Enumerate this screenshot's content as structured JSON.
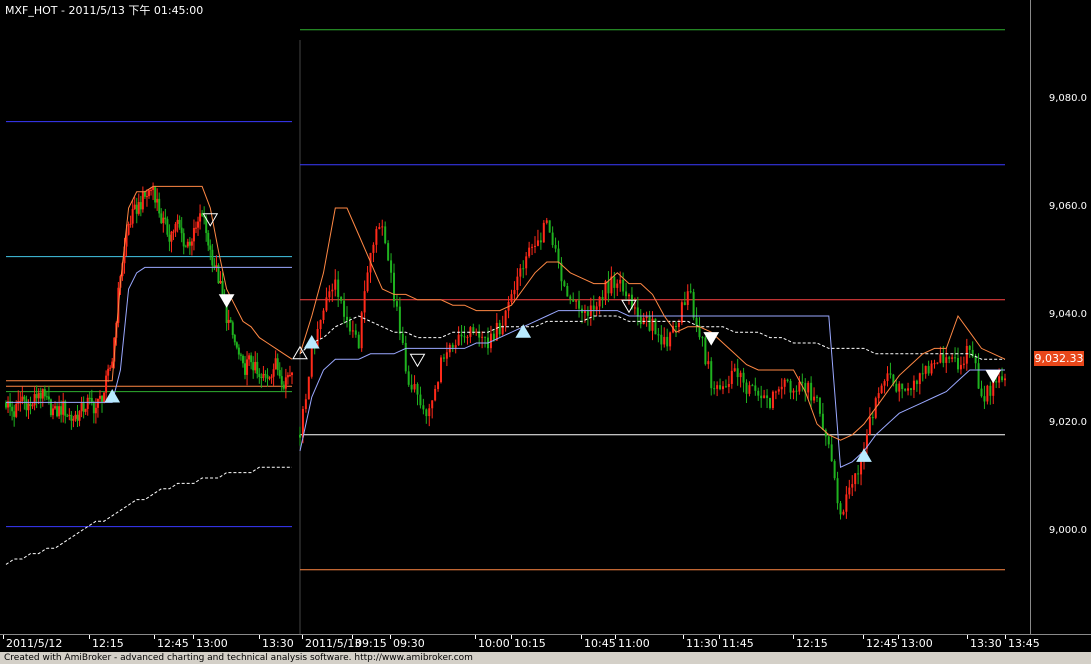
{
  "title": "MXF_HOT - 2011/5/13 下午 01:45:00",
  "footer": "Created with AmiBroker - advanced charting and technical analysis software. http://www.amibroker.com",
  "last_price_label": "9,032.33",
  "colors": {
    "background": "#000000",
    "bull_candle": "#ff2a1a",
    "bear_candle": "#1fb21f",
    "band_upper": "#3a3aff",
    "band_mid": "#44c8e8",
    "band_lower": "#2faf2f",
    "stop_line": "#ff8844",
    "trail_line": "#9aa8ff",
    "ma_line": "#ffffff",
    "price_badge": "#e8471a"
  },
  "chart_data": {
    "type": "candlestick",
    "title": "MXF_HOT - 2011/5/13 下午 01:45:00",
    "ylim": [
      8990,
      9100
    ],
    "y_ticks": [
      {
        "value": 9000,
        "label": "9,000.0"
      },
      {
        "value": 9020,
        "label": "9,020.0"
      },
      {
        "value": 9040,
        "label": "9,040.0"
      },
      {
        "value": 9060,
        "label": "9,060.0"
      },
      {
        "value": 9080,
        "label": "9,080.0"
      }
    ],
    "x_ticks": [
      "2011/5/12",
      "12:15",
      "12:45",
      "13:00",
      "13:30",
      "2011/5/13",
      "09:15",
      "09:30",
      "10:00",
      "10:15",
      "10:45",
      "11:00",
      "11:30",
      "11:45",
      "12:15",
      "12:45",
      "13:00",
      "13:30",
      "13:45"
    ],
    "last_price": 9032.33,
    "sessions": [
      {
        "date": "2011/5/12",
        "levels": [
          {
            "name": "upper-band",
            "value": 9076,
            "color": "#3a3aff"
          },
          {
            "name": "mid-band",
            "value": 9051,
            "color": "#44c8e8"
          },
          {
            "name": "stop-band",
            "value": 9027,
            "color": "#ff8844"
          },
          {
            "name": "lower-band-green",
            "value": 9026,
            "color": "#2faf2f"
          },
          {
            "name": "lower-band",
            "value": 9001,
            "color": "#3a3aff"
          }
        ],
        "close_path": [
          9024,
          9022,
          9025,
          9023,
          9026,
          9024,
          9022,
          9023,
          9021,
          9022,
          9024,
          9023,
          9026,
          9032,
          9048,
          9057,
          9060,
          9062,
          9064,
          9058,
          9055,
          9057,
          9053,
          9055,
          9059,
          9052,
          9047,
          9040,
          9035,
          9030,
          9032,
          9028,
          9029,
          9031,
          9028,
          9030
        ],
        "stop_line": [
          9028,
          9028,
          9028,
          9028,
          9028,
          9028,
          9028,
          9028,
          9028,
          9028,
          9028,
          9028,
          9028,
          9028,
          9046,
          9060,
          9063,
          9063,
          9064,
          9064,
          9064,
          9064,
          9064,
          9064,
          9064,
          9060,
          9052,
          9045,
          9042,
          9039,
          9038,
          9036,
          9035,
          9034,
          9033,
          9032
        ],
        "trail_line": [
          9024,
          9024,
          9024,
          9024,
          9024,
          9024,
          9024,
          9024,
          9024,
          9024,
          9024,
          9024,
          9024,
          9024,
          9030,
          9045,
          9048,
          9049,
          9049,
          9049,
          9049,
          9049,
          9049,
          9049,
          9049,
          9049,
          9049,
          9049,
          9049,
          9049,
          9049,
          9049,
          9049,
          9049,
          9049,
          9049
        ],
        "ma_line": [
          8994,
          8995,
          8995,
          8996,
          8996,
          8997,
          8997,
          8998,
          8999,
          9000,
          9001,
          9002,
          9002,
          9003,
          9004,
          9005,
          9006,
          9006,
          9007,
          9008,
          9008,
          9009,
          9009,
          9009,
          9010,
          9010,
          9010,
          9011,
          9011,
          9011,
          9011,
          9012,
          9012,
          9012,
          9012,
          9012
        ]
      },
      {
        "date": "2011/5/13",
        "levels": [
          {
            "name": "top-band-green",
            "value": 9093,
            "color": "#2faf2f"
          },
          {
            "name": "upper-band",
            "value": 9068,
            "color": "#3a3aff"
          },
          {
            "name": "stop-band",
            "value": 9043,
            "color": "#ff4444"
          },
          {
            "name": "lower-band-white",
            "value": 9018,
            "color": "#ffffff"
          },
          {
            "name": "bottom-band",
            "value": 8993,
            "color": "#ff8844"
          }
        ],
        "close_path": [
          9018,
          9033,
          9041,
          9046,
          9038,
          9035,
          9052,
          9058,
          9044,
          9030,
          9025,
          9022,
          9031,
          9035,
          9037,
          9036,
          9035,
          9038,
          9043,
          9050,
          9053,
          9057,
          9049,
          9043,
          9042,
          9040,
          9045,
          9047,
          9043,
          9040,
          9038,
          9035,
          9038,
          9045,
          9037,
          9028,
          9026,
          9030,
          9027,
          9025,
          9024,
          9028,
          9026,
          9027,
          9024,
          9015,
          9004,
          9008,
          9016,
          9024,
          9028,
          9027,
          9026,
          9029,
          9031,
          9033,
          9030,
          9035,
          9025,
          9027,
          9028
        ],
        "stop_line": [
          9033,
          9040,
          9048,
          9060,
          9060,
          9055,
          9050,
          9045,
          9044,
          9044,
          9043,
          9043,
          9043,
          9042,
          9042,
          9041,
          9041,
          9041,
          9042,
          9045,
          9048,
          9050,
          9050,
          9048,
          9047,
          9046,
          9046,
          9048,
          9046,
          9046,
          9044,
          9040,
          9037,
          9038,
          9038,
          9037,
          9035,
          9033,
          9031,
          9030,
          9030,
          9030,
          9030,
          9026,
          9020,
          9018,
          9017,
          9018,
          9020,
          9023,
          9026,
          9029,
          9031,
          9033,
          9034,
          9034,
          9040,
          9037,
          9034,
          9033,
          9032
        ],
        "trail_line": [
          9015,
          9025,
          9030,
          9032,
          9032,
          9032,
          9033,
          9033,
          9033,
          9034,
          9034,
          9034,
          9034,
          9034,
          9034,
          9035,
          9035,
          9036,
          9037,
          9038,
          9039,
          9040,
          9041,
          9041,
          9041,
          9041,
          9041,
          9041,
          9040,
          9040,
          9040,
          9040,
          9040,
          9040,
          9040,
          9040,
          9040,
          9040,
          9040,
          9040,
          9040,
          9040,
          9040,
          9040,
          9040,
          9040,
          9012,
          9013,
          9015,
          9018,
          9020,
          9022,
          9023,
          9024,
          9025,
          9026,
          9028,
          9030,
          9030,
          9030,
          9030
        ],
        "ma_line": [
          9033,
          9035,
          9036,
          9038,
          9039,
          9040,
          9039,
          9038,
          9037,
          9037,
          9036,
          9036,
          9036,
          9037,
          9037,
          9037,
          9037,
          9038,
          9038,
          9038,
          9038,
          9039,
          9039,
          9039,
          9039,
          9040,
          9040,
          9040,
          9039,
          9039,
          9039,
          9039,
          9039,
          9039,
          9038,
          9038,
          9038,
          9037,
          9037,
          9037,
          9036,
          9036,
          9035,
          9035,
          9035,
          9034,
          9034,
          9034,
          9034,
          9033,
          9033,
          9033,
          9033,
          9033,
          9033,
          9033,
          9033,
          9033,
          9032,
          9032,
          9032
        ]
      }
    ],
    "signals": [
      {
        "session": 0,
        "index": 13,
        "type": "buy",
        "price": 9025
      },
      {
        "session": 0,
        "index": 27,
        "type": "sell",
        "price": 9043
      },
      {
        "session": 0,
        "index": 25,
        "type": "sell-outline",
        "price": 9058
      },
      {
        "session": 1,
        "index": 1,
        "type": "buy",
        "price": 9035
      },
      {
        "session": 1,
        "index": 0,
        "type": "buy-outline",
        "price": 9033
      },
      {
        "session": 1,
        "index": 10,
        "type": "sell-outline",
        "price": 9032
      },
      {
        "session": 1,
        "index": 19,
        "type": "buy",
        "price": 9037
      },
      {
        "session": 1,
        "index": 28,
        "type": "sell-outline",
        "price": 9042
      },
      {
        "session": 1,
        "index": 35,
        "type": "sell",
        "price": 9036
      },
      {
        "session": 1,
        "index": 48,
        "type": "buy",
        "price": 9014
      },
      {
        "session": 1,
        "index": 59,
        "type": "sell",
        "price": 9029
      }
    ]
  }
}
